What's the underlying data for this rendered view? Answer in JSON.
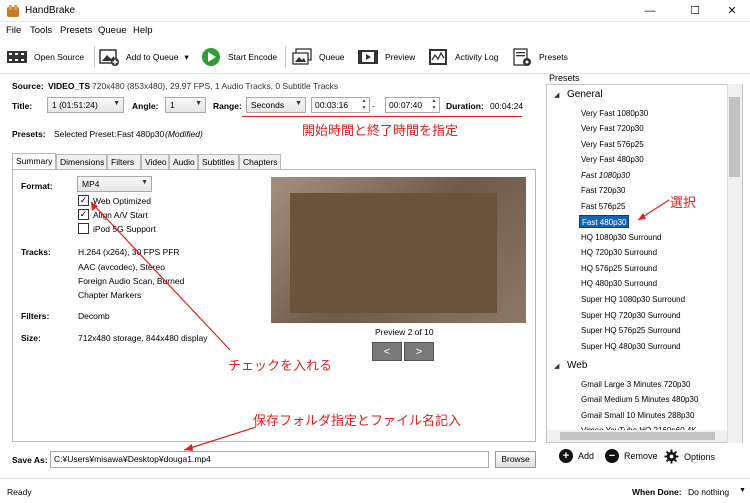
{
  "window": {
    "title": "HandBrake",
    "minimize": "—",
    "maximize": "☐",
    "close": "✕"
  },
  "menu": [
    "File",
    "Tools",
    "Presets",
    "Queue",
    "Help"
  ],
  "toolbar": {
    "open_source": "Open Source",
    "add_to_queue": "Add to Queue",
    "add_to_queue_arrow": "▾",
    "start_encode": "Start Encode",
    "queue": "Queue",
    "preview": "Preview",
    "activity_log": "Activity Log",
    "presets": "Presets"
  },
  "source": {
    "label": "Source:",
    "name": "VIDEO_TS",
    "info": "720x480 (853x480), 29.97 FPS, 1 Audio Tracks, 0 Subtitle Tracks"
  },
  "title_row": {
    "title_label": "Title:",
    "title_value": "1 (01:51:24)",
    "angle_label": "Angle:",
    "angle_value": "1",
    "range_label": "Range:",
    "range_value": "Seconds",
    "start": "00:03:16",
    "dash": "-",
    "end": "00:07:40",
    "duration_label": "Duration:",
    "duration_value": "00:04:24"
  },
  "presets_row": {
    "label": "Presets:",
    "selected_prefix": "Selected Preset:",
    "selected_name": "Fast 480p30",
    "modified": "(Modified)"
  },
  "tabs": [
    "Summary",
    "Dimensions",
    "Filters",
    "Video",
    "Audio",
    "Subtitles",
    "Chapters"
  ],
  "summary": {
    "format_label": "Format:",
    "format_value": "MP4",
    "web_optimized": "Web Optimized",
    "web_optimized_checked": true,
    "align_av": "Align A/V Start",
    "align_av_checked": true,
    "ipod": "iPod 5G Support",
    "ipod_checked": false,
    "tracks_label": "Tracks:",
    "tracks": [
      "H.264 (x264), 30 FPS PFR",
      "AAC (avcodec), Stereo",
      "Foreign Audio Scan, Burned",
      "Chapter Markers"
    ],
    "filters_label": "Filters:",
    "filters_value": "Decomb",
    "size_label": "Size:",
    "size_value": "712x480 storage, 844x480 display",
    "preview_caption": "Preview 2 of 10",
    "prev": "<",
    "next": ">"
  },
  "annotations": {
    "range": "開始時間と終了時間を指定",
    "select": "選択",
    "check": "チェックを入れる",
    "save": "保存フォルダ指定とファイル名記入",
    "color": "#e0201c"
  },
  "save": {
    "label": "Save As:",
    "path": "C:¥Users¥misawa¥Desktop¥douga1.mp4",
    "browse": "Browse"
  },
  "presets_panel": {
    "header": "Presets",
    "categories": [
      {
        "name": "General",
        "items": [
          "Very Fast 1080p30",
          "Very Fast 720p30",
          "Very Fast 576p25",
          "Very Fast 480p30",
          "Fast 1080p30",
          "Fast 720p30",
          "Fast 576p25",
          "Fast 480p30",
          "HQ 1080p30 Surround",
          "HQ 720p30 Surround",
          "HQ 576p25 Surround",
          "HQ 480p30 Surround",
          "Super HQ 1080p30 Surround",
          "Super HQ 720p30 Surround",
          "Super HQ 576p25 Surround",
          "Super HQ 480p30 Surround"
        ]
      },
      {
        "name": "Web",
        "items": [
          "Gmail Large 3 Minutes 720p30",
          "Gmail Medium 5 Minutes 480p30",
          "Gmail Small 10 Minutes 288p30",
          "Vimeo YouTube HQ 2160p60 4K"
        ]
      }
    ],
    "add": "Add",
    "remove": "Remove",
    "options": "Options"
  },
  "status": {
    "text": "Ready",
    "when_done_label": "When Done:",
    "when_done_value": "Do nothing"
  }
}
